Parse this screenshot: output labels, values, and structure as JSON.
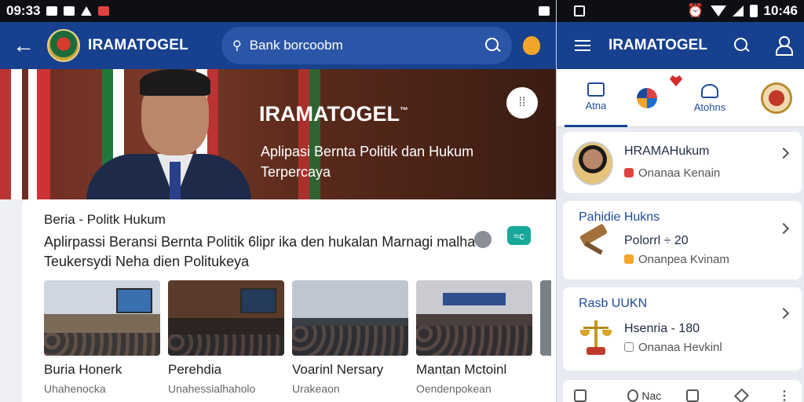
{
  "left": {
    "status": {
      "time": "09:33",
      "right_text": ""
    },
    "appbar": {
      "brand": "IRAMATOGEL",
      "search_placeholder": "Bank borcoobm"
    },
    "hero": {
      "title": "IRAMATOGEL",
      "title_mark": "™",
      "subtitle": "Aplipasi Bernta Politik dan Hukum Terpercaya"
    },
    "card": {
      "title": "Beria - Politk Hukum",
      "description": "Aplirpassi Beransi Bernta Politik 6lipr ika den hukalan Marnagi malha Teukersydi Neha dien Politukeya",
      "pill_label": "≈c",
      "thumbs": [
        {
          "title": "Buria Honerk",
          "sub": "Uhahenocka"
        },
        {
          "title": "Perehdia",
          "sub": "Unahessialhaholo"
        },
        {
          "title": "Voarinl Nersary",
          "sub": "Urakeaon"
        },
        {
          "title": "Mantan Mctoinl",
          "sub": "Oendenpokean"
        }
      ]
    }
  },
  "right": {
    "status": {
      "time": "10:46"
    },
    "appbar": {
      "brand": "IRAMATOGEL"
    },
    "tabs": [
      {
        "label": "Atna",
        "icon": "news-icon"
      },
      {
        "label": "",
        "icon": "sparkle-icon"
      },
      {
        "label": "Atohns",
        "icon": "person-icon"
      },
      {
        "label": "",
        "icon": "seal-icon"
      }
    ],
    "cards": [
      {
        "name": "HRAMAHukum",
        "sub": "Onanaa Kenain",
        "value": "",
        "accent": "#e0433f"
      },
      {
        "name": "Pahidie Hukns",
        "sub": "Onanpea Kvinam",
        "value": "Polorrl ÷ 20",
        "accent": "#f3a52a"
      },
      {
        "name": "Rasb UUKN",
        "sub": "Onanaa Hevkinl",
        "value": "Hsenria - 180",
        "accent": "#888888"
      }
    ],
    "bottom": {
      "label": "Nac"
    }
  },
  "colors": {
    "appbar": "#17408f",
    "accent_teal": "#17a89a",
    "accent_orange": "#f3a52a"
  }
}
